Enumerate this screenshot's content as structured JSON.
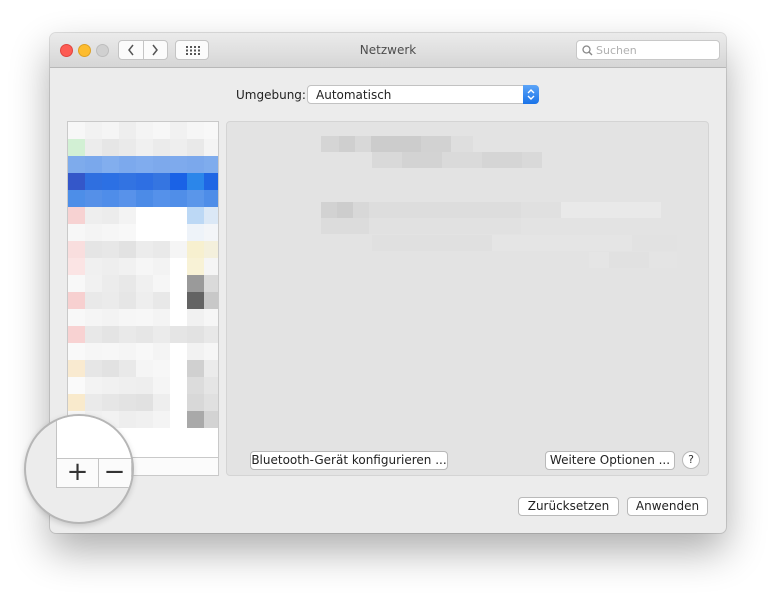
{
  "window": {
    "title": "Netzwerk",
    "search_placeholder": "Suchen"
  },
  "toolbar": {
    "back_icon": "chevron-left-icon",
    "forward_icon": "chevron-right-icon",
    "grid_icon": "grid-icon"
  },
  "location": {
    "label": "Umgebung:",
    "value": "Automatisch"
  },
  "sidebar": {
    "add_label": "+",
    "remove_label": "−"
  },
  "content": {
    "bluetooth_button": "Bluetooth-Gerät konfigurieren ...",
    "more_options_button": "Weitere Optionen ...",
    "help_label": "?"
  },
  "footer": {
    "revert_button": "Zurücksetzen",
    "apply_button": "Anwenden"
  },
  "magnifier": {
    "add_label": "+",
    "remove_label": "−"
  },
  "colors": {
    "accent": "#1a73e8",
    "close": "#fd5b53",
    "minimize": "#fdbc2e",
    "window_bg": "#ececec"
  }
}
